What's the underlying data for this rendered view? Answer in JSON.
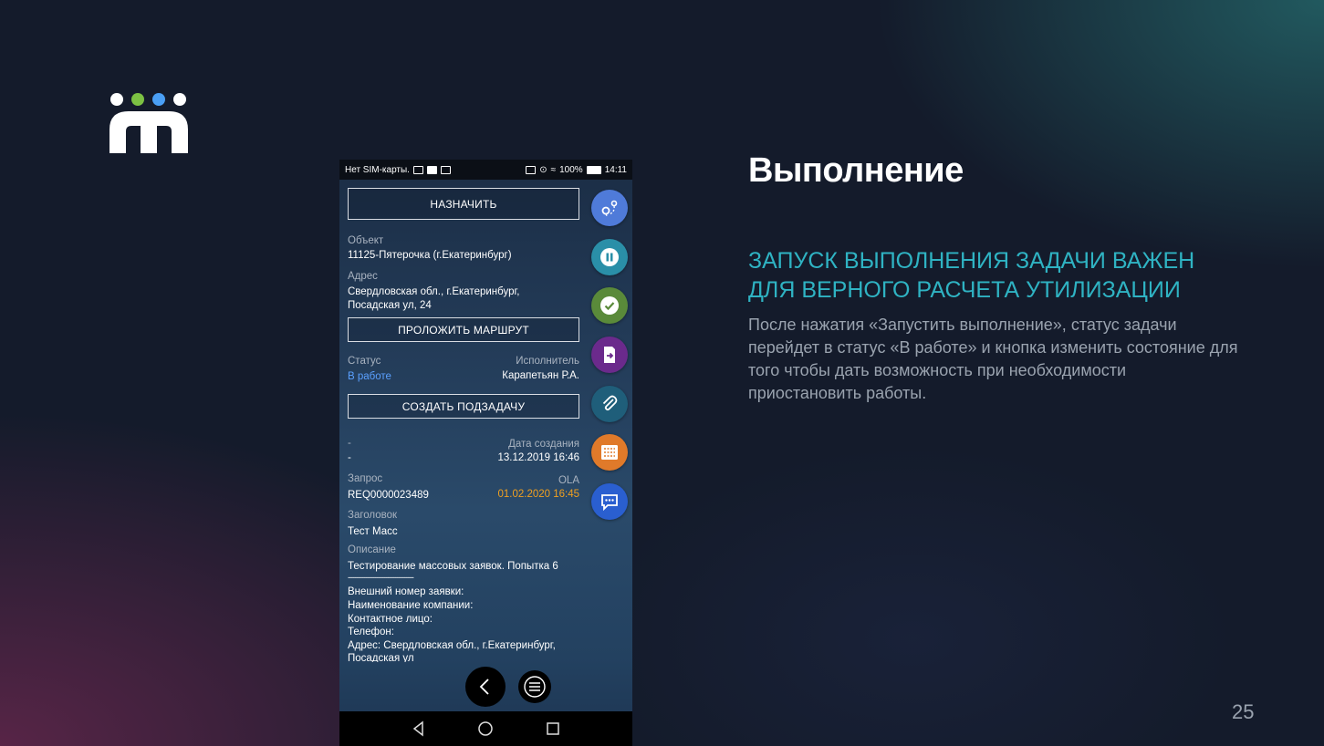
{
  "slide": {
    "title": "Выполнение",
    "subtitle": "ЗАПУСК ВЫПОЛНЕНИЯ ЗАДАЧИ ВАЖЕН ДЛЯ ВЕРНОГО РАСЧЕТА УТИЛИЗАЦИИ",
    "body": "После нажатия «Запустить выполнение», статус задачи перейдет в статус «В работе» и кнопка изменить состояние для того чтобы дать возможность при необходимости приостановить работы.",
    "page_number": "25"
  },
  "logo": {
    "dot_colors": [
      "#ffffff",
      "#7cc143",
      "#4a9ff5",
      "#ffffff"
    ]
  },
  "phone": {
    "statusbar": {
      "left": "Нет SIM-карты.",
      "battery": "100%",
      "time": "14:11"
    },
    "buttons": {
      "assign": "НАЗНАЧИТЬ",
      "route": "ПРОЛОЖИТЬ МАРШРУТ",
      "subtask": "СОЗДАТЬ ПОДЗАДАЧУ"
    },
    "fields": {
      "object_label": "Объект",
      "object_value": "11125-Пятерочка (г.Екатеринбург)",
      "address_label": "Адрес",
      "address_line1": "Свердловская обл., г.Екатеринбург,",
      "address_line2": "Посадская ул, 24",
      "status_label": "Статус",
      "status_value": "В работе",
      "executor_label": "Исполнитель",
      "executor_value": "Карапетьян Р.А.",
      "dash_label": "-",
      "dash_value": "-",
      "created_label": "Дата создания",
      "created_value": "13.12.2019 16:46",
      "request_label": "Запрос",
      "request_value": "REQ0000023489",
      "ola_label": "OLA",
      "ola_value": "01.02.2020 16:45",
      "heading_label": "Заголовок",
      "heading_value": "Тест Масс",
      "desc_label": "Описание",
      "desc_lines": [
        "Тестирование массовых заявок. Попытка 6",
        "------------------------------------",
        "Внешний номер заявки:",
        "Наименование компании:",
        "Контактное лицо:",
        "Телефон:",
        "Адрес: Свердловская обл., г.Екатеринбург,",
        "Посадская ул"
      ]
    },
    "fab_icons": [
      {
        "name": "map-route-icon",
        "color": "#4f7bd9"
      },
      {
        "name": "pause-icon",
        "color": "#2a8fa8"
      },
      {
        "name": "check-icon",
        "color": "#5a8a3a"
      },
      {
        "name": "export-icon",
        "color": "#6b2a8c"
      },
      {
        "name": "paperclip-icon",
        "color": "#1f5e7a"
      },
      {
        "name": "checklist-icon",
        "color": "#e07a2a"
      },
      {
        "name": "chat-icon",
        "color": "#2a5fd0"
      }
    ]
  }
}
